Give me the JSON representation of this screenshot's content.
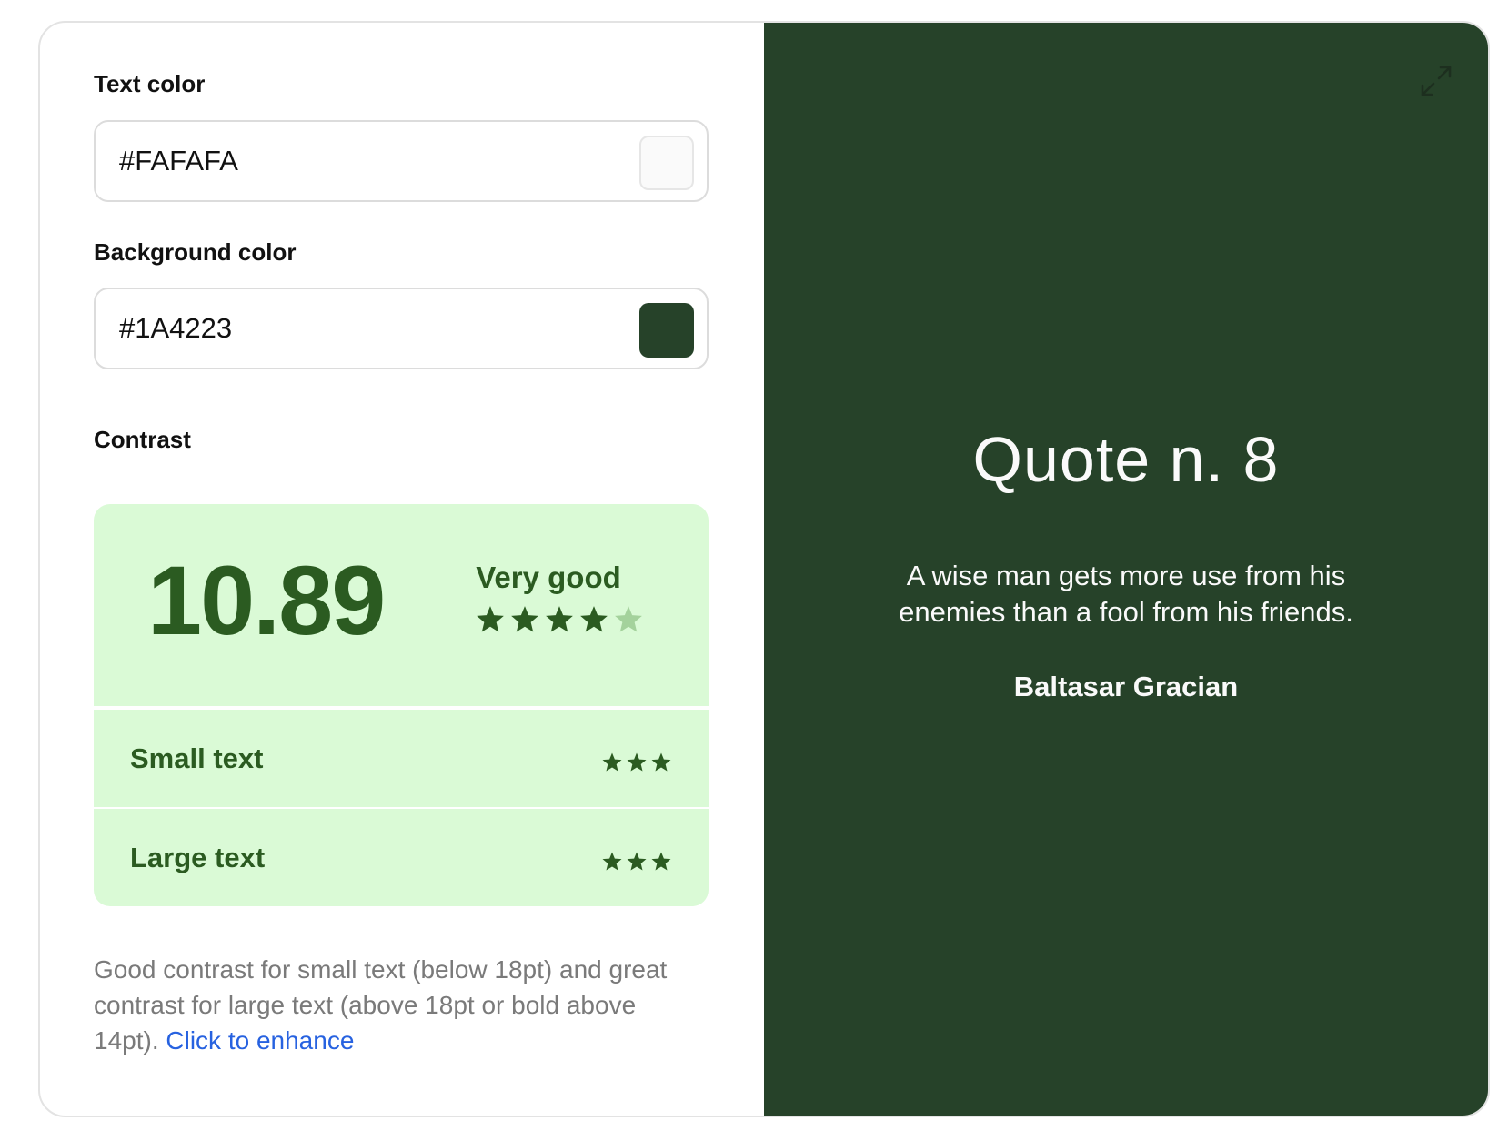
{
  "text_color": {
    "label": "Text color",
    "value": "#FAFAFA",
    "swatch_color": "#FAFAFA"
  },
  "background_color": {
    "label": "Background color",
    "value": "#1A4223",
    "swatch_color": "#264229"
  },
  "contrast": {
    "label": "Contrast",
    "ratio": "10.89",
    "rating": "Very good",
    "stars_filled": 4,
    "stars_total": 5,
    "small_text": {
      "label": "Small text",
      "stars": 3
    },
    "large_text": {
      "label": "Large text",
      "stars": 3
    },
    "description": "Good contrast for small text (below 18pt) and great contrast for large text (above 18pt or bold above 14pt).",
    "enhance_link": "Click to enhance"
  },
  "preview": {
    "expand_icon": "expand-icon",
    "title": "Quote n. 8",
    "quote": "A wise man gets more use from his enemies than a fool from his friends.",
    "author": "Baltasar Gracian"
  },
  "colors": {
    "accent_green": "#2B5B21",
    "contrast_bg": "#DAFAD6",
    "link": "#2762E0",
    "preview_bg": "#264229"
  }
}
